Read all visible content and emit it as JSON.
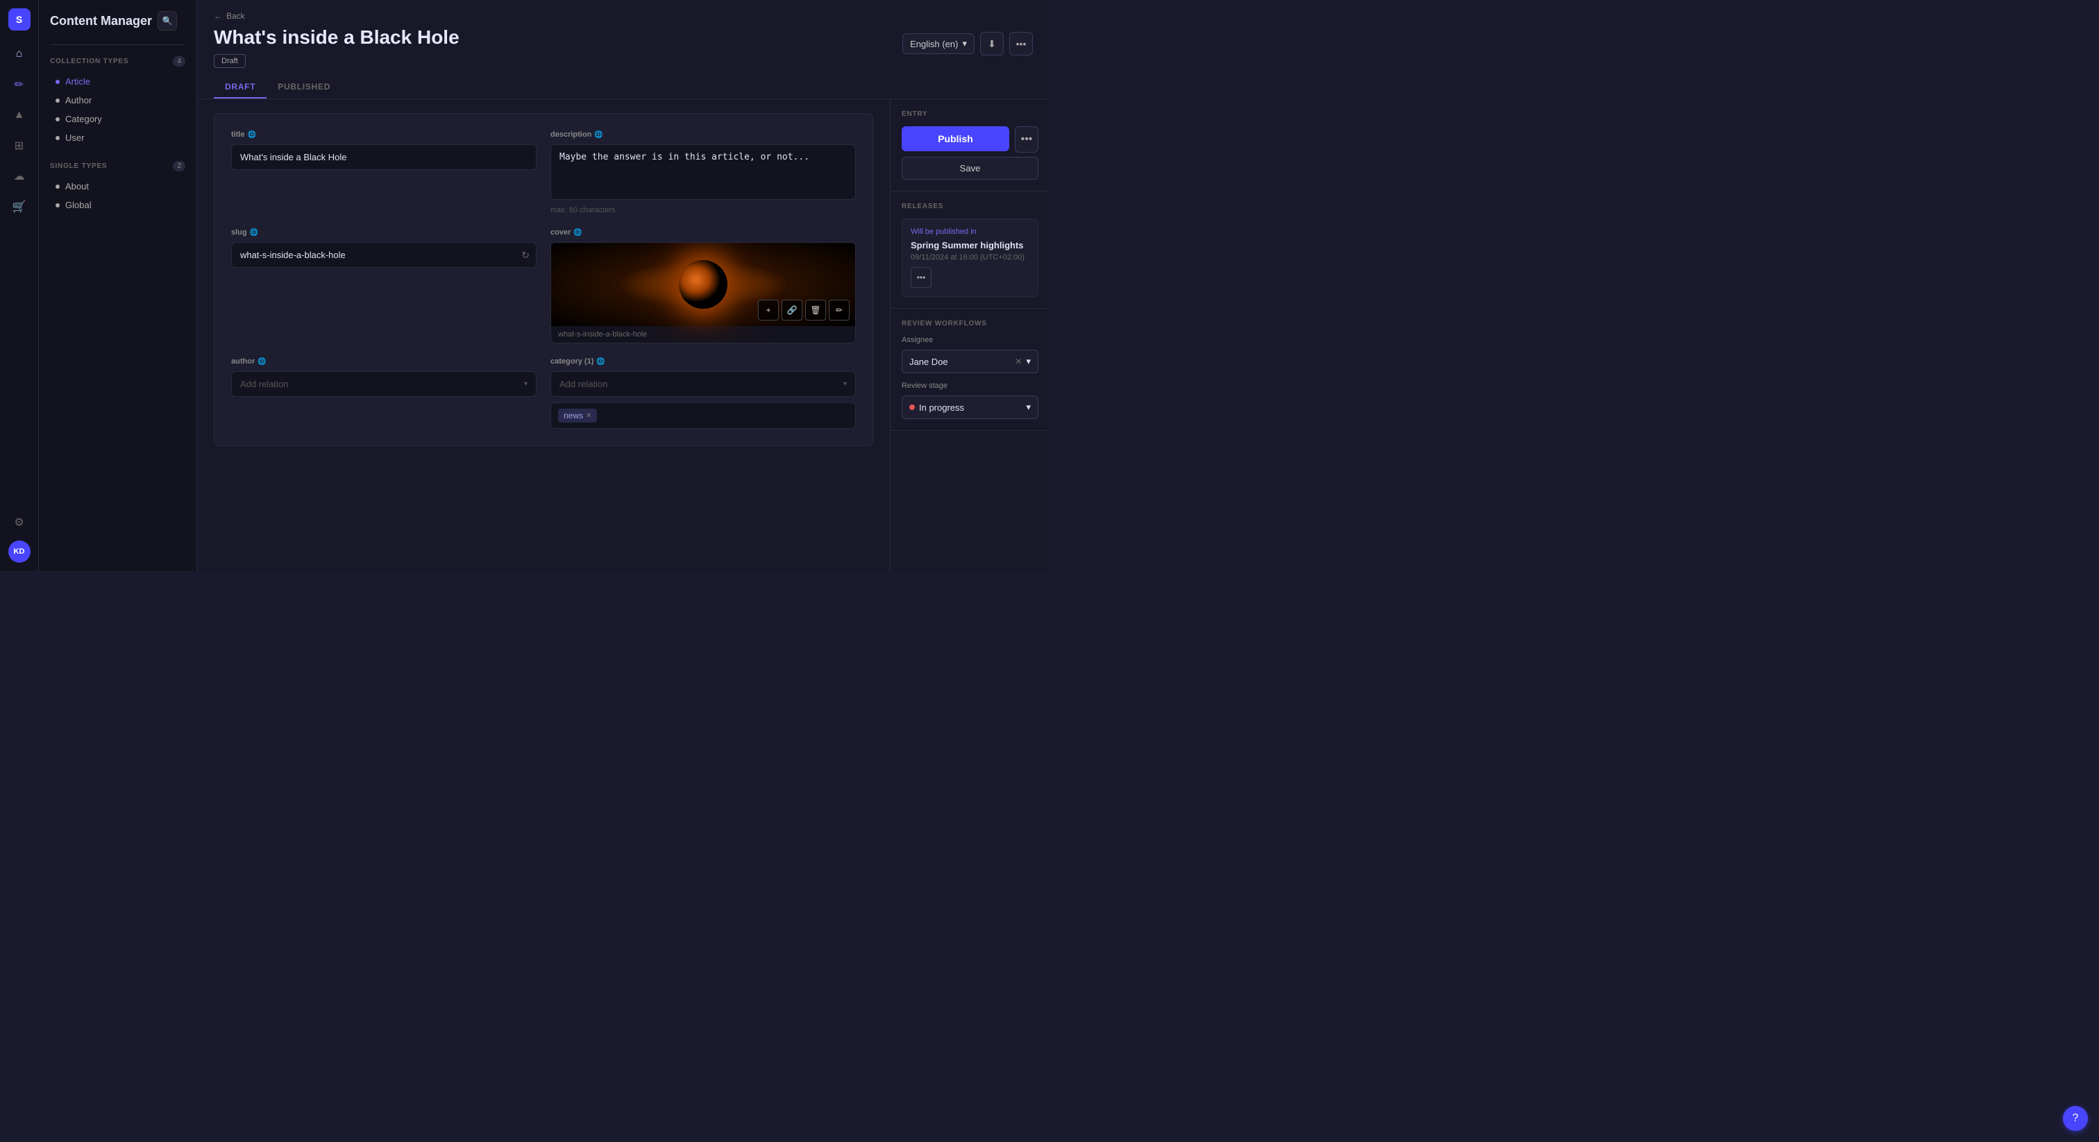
{
  "app": {
    "title": "Content Manager"
  },
  "iconBar": {
    "logoText": "S",
    "avatarText": "KD",
    "icons": [
      {
        "name": "home-icon",
        "symbol": "⌂"
      },
      {
        "name": "pencil-icon",
        "symbol": "✏"
      },
      {
        "name": "send-icon",
        "symbol": "▲"
      },
      {
        "name": "grid-icon",
        "symbol": "⊞"
      },
      {
        "name": "layers-icon",
        "symbol": "☁"
      },
      {
        "name": "cart-icon",
        "symbol": "🛒"
      },
      {
        "name": "gear-icon",
        "symbol": "⚙"
      }
    ]
  },
  "sidebar": {
    "searchPlaceholder": "Search...",
    "collectionTypes": {
      "label": "Collection Types",
      "count": 4,
      "items": [
        {
          "label": "Article",
          "active": true
        },
        {
          "label": "Author"
        },
        {
          "label": "Category"
        },
        {
          "label": "User"
        }
      ]
    },
    "singleTypes": {
      "label": "Single Types",
      "count": 2,
      "items": [
        {
          "label": "About"
        },
        {
          "label": "Global"
        }
      ]
    }
  },
  "header": {
    "backLabel": "Back",
    "title": "What's inside a Black Hole",
    "language": "English (en)",
    "draftBadge": "Draft",
    "tabs": [
      {
        "label": "Draft",
        "active": true
      },
      {
        "label": "Published"
      }
    ]
  },
  "form": {
    "titleField": {
      "label": "title",
      "value": "What's inside a Black Hole"
    },
    "descriptionField": {
      "label": "description",
      "value": "Maybe the answer is in this article, or not...",
      "hint": "max. 80 characters"
    },
    "slugField": {
      "label": "slug",
      "value": "what-s-inside-a-black-hole"
    },
    "coverField": {
      "label": "cover",
      "filename": "what-s-inside-a-black-hole"
    },
    "authorField": {
      "label": "author",
      "placeholder": "Add relation"
    },
    "categoryField": {
      "label": "category (1)",
      "placeholder": "Add relation",
      "tag": "news"
    }
  },
  "rightPanel": {
    "entry": {
      "sectionTitle": "ENTRY",
      "publishLabel": "Publish",
      "saveLabel": "Save",
      "moreIcon": "•••"
    },
    "releases": {
      "sectionTitle": "RELEASES",
      "card": {
        "willPublish": "Will be published in",
        "name": "Spring Summer highlights",
        "date": "09/11/2024 at 16:00 (UTC+02:00)",
        "moreIcon": "•••"
      }
    },
    "reviewWorkflows": {
      "sectionTitle": "REVIEW WORKFLOWS",
      "assigneeLabel": "Assignee",
      "assigneeName": "Jane Doe",
      "reviewStageLabel": "Review stage",
      "reviewStageValue": "In progress"
    }
  },
  "helpIcon": "?"
}
